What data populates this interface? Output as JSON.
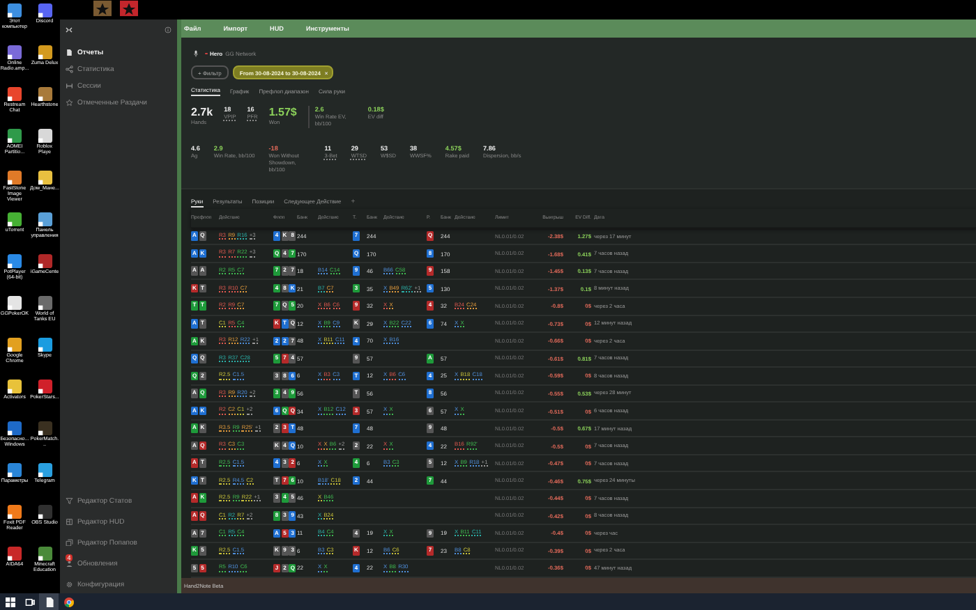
{
  "desktop": {
    "top_icons": [
      {
        "color": "#7a5a32"
      },
      {
        "color": "#c4262c"
      }
    ],
    "icons": [
      {
        "label": "Этот компьютер",
        "color": "#3d8fe0"
      },
      {
        "label": "Discord",
        "color": "#5865f2"
      },
      {
        "label": "Online Radio.amp...",
        "color": "#7a6ad8"
      },
      {
        "label": "Zuma Delux",
        "color": "#d39a1e"
      },
      {
        "label": "Restream Chat",
        "color": "#e8452c"
      },
      {
        "label": "Hearthstone",
        "color": "#a87a3a"
      },
      {
        "label": "AOMEI Partitio...",
        "color": "#2f9a4a"
      },
      {
        "label": "Roblox Playe",
        "color": "#d8d8d8"
      },
      {
        "label": "FastStone Image Viewer",
        "color": "#e07a28"
      },
      {
        "label": "Дом_Мане...",
        "color": "#e8c040"
      },
      {
        "label": "uTorrent",
        "color": "#46b034"
      },
      {
        "label": "Панель управления",
        "color": "#5aa0d8"
      },
      {
        "label": "PotPlayer (64-bit)",
        "color": "#2a8ae6"
      },
      {
        "label": "iGameCente",
        "color": "#b02828"
      },
      {
        "label": "GGPokerOK",
        "color": "#e4e4e4"
      },
      {
        "label": "World of Tanks EU",
        "color": "#6a6a6a"
      },
      {
        "label": "Google Chrome",
        "color": "#e2a020"
      },
      {
        "label": "Skype",
        "color": "#1a9ce0"
      },
      {
        "label": "Activators",
        "color": "#e8c23a"
      },
      {
        "label": "PokerStars...",
        "color": "#d0202a"
      },
      {
        "label": "Безопасно... Windows",
        "color": "#1e6ac8"
      },
      {
        "label": "PokerMatch...",
        "color": "#3a3020"
      },
      {
        "label": "Параметры",
        "color": "#2a86d8"
      },
      {
        "label": "Telegram",
        "color": "#2aa0e0"
      },
      {
        "label": "Foxit PDF Reader",
        "color": "#f07a1a"
      },
      {
        "label": "OBS Studio",
        "color": "#303030"
      },
      {
        "label": "AIDA64",
        "color": "#c82828"
      },
      {
        "label": "Minecraft Education",
        "color": "#4a8a3a"
      }
    ]
  },
  "sidebar": {
    "items": [
      {
        "label": "Отчеты",
        "kind": "document",
        "selected": true
      },
      {
        "label": "Статистика",
        "kind": "nodes",
        "selected": false
      },
      {
        "label": "Сессии",
        "kind": "bracket",
        "selected": false
      },
      {
        "label": "Отмеченные Раздачи",
        "kind": "star",
        "selected": false
      }
    ],
    "bottom_items": [
      {
        "label": "Редактор Статов",
        "kind": "funnel"
      },
      {
        "label": "Редактор HUD",
        "kind": "layout"
      },
      {
        "label": "Редактор Попапов",
        "kind": "windows"
      },
      {
        "label": "Обновления",
        "kind": "person",
        "badge": "4"
      },
      {
        "label": "Конфигурация",
        "kind": "gear"
      }
    ]
  },
  "menu": [
    "Файл",
    "Импорт",
    "HUD",
    "Инструменты"
  ],
  "header": {
    "player": "Hero",
    "network": "GG Network",
    "filter_button": "+ Фильтр",
    "date_chip": "From 30-08-2024 to 30-08-2024",
    "chip_close": "×",
    "tabs": [
      {
        "label": "Статистика",
        "selected": true
      },
      {
        "label": "График",
        "selected": false
      },
      {
        "label": "Префлоп диапазон",
        "selected": false
      },
      {
        "label": "Сила руки",
        "selected": false
      }
    ]
  },
  "stats": {
    "main": [
      {
        "value": "2.7k",
        "label": "Hands",
        "kind": "big",
        "underlined": false
      },
      {
        "value": "18",
        "label": "VPIP",
        "kind": "plain",
        "underlined": true
      },
      {
        "value": "16",
        "label": "PFR",
        "kind": "plain",
        "underlined": true
      },
      {
        "value": "1.57$",
        "label": "Won",
        "kind": "bigpositive",
        "underlined": false
      },
      {
        "value": "2.6",
        "label": "Win Rate EV, bb/100",
        "kind": "positive",
        "underlined": false
      },
      {
        "value": "0.18$",
        "label": "EV diff",
        "kind": "positive",
        "underlined": false
      }
    ],
    "more": [
      {
        "value": "4.6",
        "label": "Ag",
        "kind": "plain",
        "underlined": false
      },
      {
        "value": "2.9",
        "label": "Win Rate, bb/100",
        "kind": "positive",
        "underlined": false
      },
      {
        "value": "-18",
        "label": "Won Without Showdown, bb/100",
        "kind": "negative",
        "underlined": false
      },
      {
        "value": "11",
        "label": "3-Bet",
        "kind": "plain",
        "underlined": true
      },
      {
        "value": "29",
        "label": "WTSD",
        "kind": "plain",
        "underlined": true
      },
      {
        "value": "53",
        "label": "W$SD",
        "kind": "plain",
        "underlined": false
      },
      {
        "value": "38",
        "label": "WWSF%",
        "kind": "plain",
        "underlined": false
      },
      {
        "value": "4.57$",
        "label": "Rake paid",
        "kind": "positive",
        "underlined": false
      },
      {
        "value": "7.86",
        "label": "Dispersion, bb/s",
        "kind": "plain",
        "underlined": false
      }
    ]
  },
  "hands": {
    "tabs": [
      {
        "label": "Руки",
        "selected": true
      },
      {
        "label": "Результаты",
        "selected": false
      },
      {
        "label": "Позиции",
        "selected": false
      },
      {
        "label": "Следующее Действие",
        "selected": false
      }
    ],
    "add_tab": "+",
    "columns": [
      "Префлоп",
      "Действие",
      "Флоп",
      "Банк",
      "Действие",
      "Т.",
      "Банк",
      "Действие",
      "Р.",
      "Банк",
      "Действие",
      "Лимит",
      "Выигрыш",
      "EV Diff.",
      "Дата"
    ],
    "rows": [
      {
        "hole": [
          {
            "rank": "A",
            "color": "#1f6fd1"
          },
          {
            "rank": "Q",
            "color": "#555555"
          }
        ],
        "pre": [
          {
            "text": "R3",
            "color": "#e0584f"
          },
          {
            "text": "R9",
            "color": "#e09a3c"
          },
          {
            "text": "R16",
            "color": "#2bb0a8"
          },
          {
            "text": "+3",
            "color": "#9a9a9a"
          }
        ],
        "flop": [
          {
            "rank": "4",
            "color": "#1f6fd1"
          },
          {
            "rank": "K",
            "color": "#555555"
          },
          {
            "rank": "8",
            "color": "#555555"
          }
        ],
        "flop_pot": "244",
        "flop_act": [],
        "turn": {
          "rank": "7",
          "color": "#1f6fd1"
        },
        "turn_pot": "244",
        "turn_act": [],
        "river": {
          "rank": "Q",
          "color": "#b52a2a"
        },
        "river_pot": "244",
        "river_act": [],
        "limit": "NL0.01/0.02",
        "won": "-2.38$",
        "ev_diff": "1.27$",
        "ev_positive": true,
        "date": "через 17 минут"
      },
      {
        "hole": [
          {
            "rank": "A",
            "color": "#1f6fd1"
          },
          {
            "rank": "K",
            "color": "#1f6fd1"
          }
        ],
        "pre": [
          {
            "text": "R3",
            "color": "#e0584f"
          },
          {
            "text": "R7",
            "color": "#e0584f"
          },
          {
            "text": "R22",
            "color": "#3fb950"
          },
          {
            "text": "+3",
            "color": "#9a9a9a"
          }
        ],
        "flop": [
          {
            "rank": "Q",
            "color": "#1e9a3a"
          },
          {
            "rank": "4",
            "color": "#555555"
          },
          {
            "rank": "7",
            "color": "#1e9a3a"
          }
        ],
        "flop_pot": "170",
        "flop_act": [],
        "turn": {
          "rank": "Q",
          "color": "#1f6fd1"
        },
        "turn_pot": "170",
        "turn_act": [],
        "river": {
          "rank": "8",
          "color": "#1f6fd1"
        },
        "river_pot": "170",
        "river_act": [],
        "limit": "NL0.01/0.02",
        "won": "-1.68$",
        "ev_diff": "0.41$",
        "ev_positive": true,
        "date": "7 часов назад"
      },
      {
        "hole": [
          {
            "rank": "A",
            "color": "#555555"
          },
          {
            "rank": "A",
            "color": "#555555"
          }
        ],
        "pre": [
          {
            "text": "R2",
            "color": "#3fb950"
          },
          {
            "text": "R5",
            "color": "#3fb950"
          },
          {
            "text": "C7",
            "color": "#3fb950"
          }
        ],
        "flop": [
          {
            "rank": "7",
            "color": "#1e9a3a"
          },
          {
            "rank": "2",
            "color": "#555555"
          },
          {
            "rank": "7",
            "color": "#555555"
          }
        ],
        "flop_pot": "18",
        "flop_act": [
          {
            "text": "B14",
            "color": "#4f8fdc"
          },
          {
            "text": "C14",
            "color": "#3fb950"
          }
        ],
        "turn": {
          "rank": "9",
          "color": "#1f6fd1"
        },
        "turn_pot": "46",
        "turn_act": [
          {
            "text": "B66",
            "color": "#4f8fdc"
          },
          {
            "text": "C58",
            "color": "#3fb950"
          }
        ],
        "river": {
          "rank": "9",
          "color": "#b52a2a"
        },
        "river_pot": "158",
        "river_act": [],
        "limit": "NL0.01/0.02",
        "won": "-1.45$",
        "ev_diff": "0.13$",
        "ev_positive": true,
        "date": "7 часов назад"
      },
      {
        "hole": [
          {
            "rank": "K",
            "color": "#b52a2a"
          },
          {
            "rank": "T",
            "color": "#555555"
          }
        ],
        "pre": [
          {
            "text": "R3",
            "color": "#e0584f"
          },
          {
            "text": "R10",
            "color": "#e0584f"
          },
          {
            "text": "C7",
            "color": "#e09a3c"
          }
        ],
        "flop": [
          {
            "rank": "4",
            "color": "#1e9a3a"
          },
          {
            "rank": "8",
            "color": "#555555"
          },
          {
            "rank": "K",
            "color": "#1f6fd1"
          }
        ],
        "flop_pot": "21",
        "flop_act": [
          {
            "text": "B7",
            "color": "#2bb0a8"
          },
          {
            "text": "C7",
            "color": "#e09a3c"
          }
        ],
        "turn": {
          "rank": "3",
          "color": "#1e9a3a"
        },
        "turn_pot": "35",
        "turn_act": [
          {
            "text": "X",
            "color": "#4f8fdc"
          },
          {
            "text": "B49",
            "color": "#e09a3c"
          },
          {
            "text": "R62'",
            "color": "#2bb0a8"
          },
          {
            "text": "+1",
            "color": "#9a9a9a"
          }
        ],
        "river": {
          "rank": "5",
          "color": "#1f6fd1"
        },
        "river_pot": "130",
        "river_act": [],
        "limit": "NL0.01/0.02",
        "won": "-1.37$",
        "ev_diff": "0.1$",
        "ev_positive": true,
        "date": "8 минут назад"
      },
      {
        "hole": [
          {
            "rank": "T",
            "color": "#1e9a3a"
          },
          {
            "rank": "T",
            "color": "#1e9a3a"
          }
        ],
        "pre": [
          {
            "text": "R2",
            "color": "#e0584f"
          },
          {
            "text": "R9",
            "color": "#e0584f"
          },
          {
            "text": "C7",
            "color": "#e09a3c"
          }
        ],
        "flop": [
          {
            "rank": "7",
            "color": "#1e9a3a"
          },
          {
            "rank": "Q",
            "color": "#555555"
          },
          {
            "rank": "5",
            "color": "#1e9a3a"
          }
        ],
        "flop_pot": "20",
        "flop_act": [
          {
            "text": "X",
            "color": "#e0584f"
          },
          {
            "text": "B6",
            "color": "#e0584f"
          },
          {
            "text": "C6",
            "color": "#e0584f"
          }
        ],
        "turn": {
          "rank": "9",
          "color": "#b52a2a"
        },
        "turn_pot": "32",
        "turn_act": [
          {
            "text": "X",
            "color": "#e0584f"
          },
          {
            "text": "X",
            "color": "#e09a3c"
          }
        ],
        "river": {
          "rank": "4",
          "color": "#b52a2a"
        },
        "river_pot": "32",
        "river_act": [
          {
            "text": "B24",
            "color": "#e0584f"
          },
          {
            "text": "C24",
            "color": "#e09a3c"
          }
        ],
        "limit": "NL0.01/0.02",
        "won": "-0.8$",
        "ev_diff": "0$",
        "ev_positive": false,
        "date": "через 2 часа"
      },
      {
        "hole": [
          {
            "rank": "A",
            "color": "#1f6fd1"
          },
          {
            "rank": "T",
            "color": "#555555"
          }
        ],
        "pre": [
          {
            "text": "C1",
            "color": "#c9c23a"
          },
          {
            "text": "R5",
            "color": "#e0584f"
          },
          {
            "text": "C4",
            "color": "#3fb950"
          }
        ],
        "flop": [
          {
            "rank": "K",
            "color": "#b52a2a"
          },
          {
            "rank": "T",
            "color": "#1f6fd1"
          },
          {
            "rank": "Q",
            "color": "#555555"
          }
        ],
        "flop_pot": "12",
        "flop_act": [
          {
            "text": "X",
            "color": "#4f8fdc"
          },
          {
            "text": "B9",
            "color": "#3fb950"
          },
          {
            "text": "C9",
            "color": "#4f8fdc"
          }
        ],
        "turn": {
          "rank": "K",
          "color": "#555555"
        },
        "turn_pot": "29",
        "turn_act": [
          {
            "text": "X",
            "color": "#4f8fdc"
          },
          {
            "text": "B22",
            "color": "#3fb950"
          },
          {
            "text": "C22",
            "color": "#4f8fdc"
          }
        ],
        "river": {
          "rank": "6",
          "color": "#1f6fd1"
        },
        "river_pot": "74",
        "river_act": [
          {
            "text": "X",
            "color": "#4f8fdc"
          },
          {
            "text": "X",
            "color": "#3fb950"
          }
        ],
        "limit": "NL0.01/0.02",
        "won": "-0.73$",
        "ev_diff": "0$",
        "ev_positive": false,
        "date": "12 минут назад"
      },
      {
        "hole": [
          {
            "rank": "A",
            "color": "#1e9a3a"
          },
          {
            "rank": "K",
            "color": "#555555"
          }
        ],
        "pre": [
          {
            "text": "R3",
            "color": "#e0584f"
          },
          {
            "text": "R12",
            "color": "#e09a3c"
          },
          {
            "text": "R22",
            "color": "#4f8fdc"
          },
          {
            "text": "+1",
            "color": "#9a9a9a"
          }
        ],
        "flop": [
          {
            "rank": "2",
            "color": "#1f6fd1"
          },
          {
            "rank": "2",
            "color": "#1f6fd1"
          },
          {
            "rank": "7",
            "color": "#555555"
          }
        ],
        "flop_pot": "48",
        "flop_act": [
          {
            "text": "X",
            "color": "#4f8fdc"
          },
          {
            "text": "B11",
            "color": "#c9c23a"
          },
          {
            "text": "C11",
            "color": "#4f8fdc"
          }
        ],
        "turn": {
          "rank": "4",
          "color": "#1f6fd1"
        },
        "turn_pot": "70",
        "turn_act": [
          {
            "text": "X",
            "color": "#4f8fdc"
          },
          {
            "text": "B16",
            "color": "#4f8fdc"
          }
        ],
        "river": null,
        "river_act": [],
        "limit": "NL0.01/0.02",
        "won": "-0.66$",
        "ev_diff": "0$",
        "ev_positive": false,
        "date": "через 2 часа"
      },
      {
        "hole": [
          {
            "rank": "Q",
            "color": "#1f6fd1"
          },
          {
            "rank": "Q",
            "color": "#555555"
          }
        ],
        "pre": [
          {
            "text": "R3",
            "color": "#2bb0a8"
          },
          {
            "text": "R37",
            "color": "#2bb0a8"
          },
          {
            "text": "C28",
            "color": "#2bb0a8"
          }
        ],
        "flop": [
          {
            "rank": "5",
            "color": "#1e9a3a"
          },
          {
            "rank": "7",
            "color": "#b52a2a"
          },
          {
            "rank": "4",
            "color": "#555555"
          }
        ],
        "flop_pot": "57",
        "flop_act": [],
        "turn": {
          "rank": "9",
          "color": "#555555"
        },
        "turn_pot": "57",
        "turn_act": [],
        "river": {
          "rank": "A",
          "color": "#1e9a3a"
        },
        "river_pot": "57",
        "river_act": [],
        "limit": "NL0.01/0.02",
        "won": "-0.61$",
        "ev_diff": "0.81$",
        "ev_positive": true,
        "date": "7 часов назад"
      },
      {
        "hole": [
          {
            "rank": "Q",
            "color": "#1e9a3a"
          },
          {
            "rank": "2",
            "color": "#555555"
          }
        ],
        "pre": [
          {
            "text": "R2.5",
            "color": "#c9c23a"
          },
          {
            "text": "C1.5",
            "color": "#4f8fdc"
          }
        ],
        "flop": [
          {
            "rank": "3",
            "color": "#555555"
          },
          {
            "rank": "8",
            "color": "#555555"
          },
          {
            "rank": "6",
            "color": "#1f6fd1"
          }
        ],
        "flop_pot": "6",
        "flop_act": [
          {
            "text": "X",
            "color": "#4f8fdc"
          },
          {
            "text": "B3",
            "color": "#e0584f"
          },
          {
            "text": "C3",
            "color": "#4f8fdc"
          }
        ],
        "turn": {
          "rank": "T",
          "color": "#1f6fd1"
        },
        "turn_pot": "12",
        "turn_act": [
          {
            "text": "X",
            "color": "#4f8fdc"
          },
          {
            "text": "B6",
            "color": "#e0584f"
          },
          {
            "text": "C6",
            "color": "#4f8fdc"
          }
        ],
        "river": {
          "rank": "4",
          "color": "#1f6fd1"
        },
        "river_pot": "25",
        "river_act": [
          {
            "text": "X",
            "color": "#4f8fdc"
          },
          {
            "text": "B18",
            "color": "#c9c23a"
          },
          {
            "text": "C18",
            "color": "#4f8fdc"
          }
        ],
        "limit": "NL0.01/0.02",
        "won": "-0.59$",
        "ev_diff": "0$",
        "ev_positive": false,
        "date": "8 часов назад"
      },
      {
        "hole": [
          {
            "rank": "A",
            "color": "#555555"
          },
          {
            "rank": "Q",
            "color": "#1e9a3a"
          }
        ],
        "pre": [
          {
            "text": "R3",
            "color": "#e0584f"
          },
          {
            "text": "R9",
            "color": "#e09a3c"
          },
          {
            "text": "R20",
            "color": "#4f8fdc"
          },
          {
            "text": "+2",
            "color": "#9a9a9a"
          }
        ],
        "flop": [
          {
            "rank": "3",
            "color": "#1e9a3a"
          },
          {
            "rank": "4",
            "color": "#555555"
          },
          {
            "rank": "9",
            "color": "#1e9a3a"
          }
        ],
        "flop_pot": "56",
        "flop_act": [],
        "turn": {
          "rank": "T",
          "color": "#555555"
        },
        "turn_pot": "56",
        "turn_act": [],
        "river": {
          "rank": "8",
          "color": "#1f6fd1"
        },
        "river_pot": "56",
        "river_act": [],
        "limit": "NL0.01/0.02",
        "won": "-0.55$",
        "ev_diff": "0.53$",
        "ev_positive": true,
        "date": "через 28 минут"
      },
      {
        "hole": [
          {
            "rank": "A",
            "color": "#1f6fd1"
          },
          {
            "rank": "K",
            "color": "#1f6fd1"
          }
        ],
        "pre": [
          {
            "text": "R2",
            "color": "#e0584f"
          },
          {
            "text": "C2",
            "color": "#e09a3c"
          },
          {
            "text": "C1",
            "color": "#c9c23a"
          },
          {
            "text": "+2",
            "color": "#9a9a9a"
          }
        ],
        "flop": [
          {
            "rank": "6",
            "color": "#1f6fd1"
          },
          {
            "rank": "Q",
            "color": "#1e9a3a"
          },
          {
            "rank": "Q",
            "color": "#b52a2a"
          }
        ],
        "flop_pot": "34",
        "flop_act": [
          {
            "text": "X",
            "color": "#4f8fdc"
          },
          {
            "text": "B12",
            "color": "#3fb950"
          },
          {
            "text": "C12",
            "color": "#4f8fdc"
          }
        ],
        "turn": {
          "rank": "3",
          "color": "#b52a2a"
        },
        "turn_pot": "57",
        "turn_act": [
          {
            "text": "X",
            "color": "#4f8fdc"
          },
          {
            "text": "X",
            "color": "#3fb950"
          }
        ],
        "river": {
          "rank": "6",
          "color": "#555555"
        },
        "river_pot": "57",
        "river_act": [
          {
            "text": "X",
            "color": "#4f8fdc"
          },
          {
            "text": "X",
            "color": "#3fb950"
          }
        ],
        "limit": "NL0.01/0.02",
        "won": "-0.51$",
        "ev_diff": "0$",
        "ev_positive": false,
        "date": "6 часов назад"
      },
      {
        "hole": [
          {
            "rank": "A",
            "color": "#1e9a3a"
          },
          {
            "rank": "K",
            "color": "#555555"
          }
        ],
        "pre": [
          {
            "text": "R3.5",
            "color": "#e09a3c"
          },
          {
            "text": "R9",
            "color": "#3fb950"
          },
          {
            "text": "R25'",
            "color": "#e09a3c"
          },
          {
            "text": "+1",
            "color": "#9a9a9a"
          }
        ],
        "flop": [
          {
            "rank": "2",
            "color": "#555555"
          },
          {
            "rank": "3",
            "color": "#b52a2a"
          },
          {
            "rank": "T",
            "color": "#1f6fd1"
          }
        ],
        "flop_pot": "48",
        "flop_act": [],
        "turn": {
          "rank": "7",
          "color": "#1f6fd1"
        },
        "turn_pot": "48",
        "turn_act": [],
        "river": {
          "rank": "9",
          "color": "#555555"
        },
        "river_pot": "48",
        "river_act": [],
        "limit": "NL0.01/0.02",
        "won": "-0.5$",
        "ev_diff": "0.67$",
        "ev_positive": true,
        "date": "17 минут назад"
      },
      {
        "hole": [
          {
            "rank": "A",
            "color": "#555555"
          },
          {
            "rank": "Q",
            "color": "#b52a2a"
          }
        ],
        "pre": [
          {
            "text": "R3",
            "color": "#e0584f"
          },
          {
            "text": "C3",
            "color": "#e09a3c"
          },
          {
            "text": "C3",
            "color": "#3fb950"
          }
        ],
        "flop": [
          {
            "rank": "K",
            "color": "#555555"
          },
          {
            "rank": "4",
            "color": "#555555"
          },
          {
            "rank": "Q",
            "color": "#1f6fd1"
          }
        ],
        "flop_pot": "10",
        "flop_act": [
          {
            "text": "X",
            "color": "#e0584f"
          },
          {
            "text": "X",
            "color": "#e09a3c"
          },
          {
            "text": "B6",
            "color": "#3fb950"
          },
          {
            "text": "+2",
            "color": "#9a9a9a"
          }
        ],
        "turn": {
          "rank": "2",
          "color": "#555555"
        },
        "turn_pot": "22",
        "turn_act": [
          {
            "text": "X",
            "color": "#e0584f"
          },
          {
            "text": "X",
            "color": "#3fb950"
          }
        ],
        "river": {
          "rank": "4",
          "color": "#1f6fd1"
        },
        "river_pot": "22",
        "river_act": [
          {
            "text": "B16",
            "color": "#e0584f"
          },
          {
            "text": "R92'",
            "color": "#3fb950"
          }
        ],
        "limit": "NL0.01/0.02",
        "won": "-0.5$",
        "ev_diff": "0$",
        "ev_positive": false,
        "date": "7 часов назад"
      },
      {
        "hole": [
          {
            "rank": "A",
            "color": "#b52a2a"
          },
          {
            "rank": "T",
            "color": "#555555"
          }
        ],
        "pre": [
          {
            "text": "R2.5",
            "color": "#3fb950"
          },
          {
            "text": "C1.5",
            "color": "#4f8fdc"
          }
        ],
        "flop": [
          {
            "rank": "4",
            "color": "#1f6fd1"
          },
          {
            "rank": "3",
            "color": "#555555"
          },
          {
            "rank": "2",
            "color": "#b52a2a"
          }
        ],
        "flop_pot": "6",
        "flop_act": [
          {
            "text": "X",
            "color": "#4f8fdc"
          },
          {
            "text": "X",
            "color": "#3fb950"
          }
        ],
        "turn": {
          "rank": "4",
          "color": "#1e9a3a"
        },
        "turn_pot": "6",
        "turn_act": [
          {
            "text": "B3",
            "color": "#4f8fdc"
          },
          {
            "text": "C3",
            "color": "#3fb950"
          }
        ],
        "river": {
          "rank": "5",
          "color": "#555555"
        },
        "river_pot": "12",
        "river_act": [
          {
            "text": "X",
            "color": "#4f8fdc"
          },
          {
            "text": "B9",
            "color": "#3fb950"
          },
          {
            "text": "R18",
            "color": "#4f8fdc"
          },
          {
            "text": "+1",
            "color": "#9a9a9a"
          }
        ],
        "limit": "NL0.01/0.02",
        "won": "-0.47$",
        "ev_diff": "0$",
        "ev_positive": false,
        "date": "7 часов назад"
      },
      {
        "hole": [
          {
            "rank": "K",
            "color": "#1f6fd1"
          },
          {
            "rank": "T",
            "color": "#555555"
          }
        ],
        "pre": [
          {
            "text": "R2.5",
            "color": "#c9c23a"
          },
          {
            "text": "R4.5",
            "color": "#4f8fdc"
          },
          {
            "text": "C2",
            "color": "#c9c23a"
          }
        ],
        "flop": [
          {
            "rank": "T",
            "color": "#555555"
          },
          {
            "rank": "7",
            "color": "#b52a2a"
          },
          {
            "rank": "6",
            "color": "#1e9a3a"
          }
        ],
        "flop_pot": "10",
        "flop_act": [
          {
            "text": "B18'",
            "color": "#4f8fdc"
          },
          {
            "text": "C18",
            "color": "#c9c23a"
          }
        ],
        "turn": {
          "rank": "2",
          "color": "#1f6fd1"
        },
        "turn_pot": "44",
        "turn_act": [],
        "river": {
          "rank": "7",
          "color": "#1e9a3a"
        },
        "river_pot": "44",
        "river_act": [],
        "limit": "NL0.01/0.02",
        "won": "-0.46$",
        "ev_diff": "0.75$",
        "ev_positive": true,
        "date": "через 24 минуты"
      },
      {
        "hole": [
          {
            "rank": "A",
            "color": "#b52a2a"
          },
          {
            "rank": "K",
            "color": "#1e9a3a"
          }
        ],
        "pre": [
          {
            "text": "R2.5",
            "color": "#c9c23a"
          },
          {
            "text": "R9",
            "color": "#3fb950"
          },
          {
            "text": "R22",
            "color": "#c9c23a"
          },
          {
            "text": "+1",
            "color": "#9a9a9a"
          }
        ],
        "flop": [
          {
            "rank": "3",
            "color": "#555555"
          },
          {
            "rank": "4",
            "color": "#1e9a3a"
          },
          {
            "rank": "5",
            "color": "#555555"
          }
        ],
        "flop_pot": "46",
        "flop_act": [
          {
            "text": "X",
            "color": "#c9c23a"
          },
          {
            "text": "B46",
            "color": "#3fb950"
          }
        ],
        "turn": null,
        "turn_act": [],
        "river": null,
        "river_act": [],
        "limit": "NL0.01/0.02",
        "won": "-0.44$",
        "ev_diff": "0$",
        "ev_positive": false,
        "date": "7 часов назад"
      },
      {
        "hole": [
          {
            "rank": "A",
            "color": "#b52a2a"
          },
          {
            "rank": "Q",
            "color": "#b52a2a"
          }
        ],
        "pre": [
          {
            "text": "C1",
            "color": "#c9c23a"
          },
          {
            "text": "R2",
            "color": "#2bb0a8"
          },
          {
            "text": "R7",
            "color": "#c9c23a"
          },
          {
            "text": "+2",
            "color": "#9a9a9a"
          }
        ],
        "flop": [
          {
            "rank": "8",
            "color": "#1e9a3a"
          },
          {
            "rank": "3",
            "color": "#555555"
          },
          {
            "rank": "9",
            "color": "#1f6fd1"
          }
        ],
        "flop_pot": "43",
        "flop_act": [
          {
            "text": "X",
            "color": "#2bb0a8"
          },
          {
            "text": "B24",
            "color": "#c9c23a"
          }
        ],
        "turn": null,
        "turn_act": [],
        "river": null,
        "river_act": [],
        "limit": "NL0.01/0.02",
        "won": "-0.42$",
        "ev_diff": "0$",
        "ev_positive": false,
        "date": "8 часов назад"
      },
      {
        "hole": [
          {
            "rank": "A",
            "color": "#555555"
          },
          {
            "rank": "7",
            "color": "#555555"
          }
        ],
        "pre": [
          {
            "text": "C1",
            "color": "#3fb950"
          },
          {
            "text": "R5",
            "color": "#2bb0a8"
          },
          {
            "text": "C4",
            "color": "#3fb950"
          }
        ],
        "flop": [
          {
            "rank": "A",
            "color": "#1f6fd1"
          },
          {
            "rank": "5",
            "color": "#b52a2a"
          },
          {
            "rank": "3",
            "color": "#1f6fd1"
          }
        ],
        "flop_pot": "11",
        "flop_act": [
          {
            "text": "B4",
            "color": "#2bb0a8"
          },
          {
            "text": "C4",
            "color": "#3fb950"
          }
        ],
        "turn": {
          "rank": "4",
          "color": "#555555"
        },
        "turn_pot": "19",
        "turn_act": [
          {
            "text": "X",
            "color": "#2bb0a8"
          },
          {
            "text": "X",
            "color": "#3fb950"
          }
        ],
        "river": {
          "rank": "9",
          "color": "#555555"
        },
        "river_pot": "19",
        "river_act": [
          {
            "text": "X",
            "color": "#2bb0a8"
          },
          {
            "text": "B11",
            "color": "#3fb950"
          },
          {
            "text": "C11",
            "color": "#2bb0a8"
          }
        ],
        "limit": "NL0.01/0.02",
        "won": "-0.4$",
        "ev_diff": "0$",
        "ev_positive": false,
        "date": "через час"
      },
      {
        "hole": [
          {
            "rank": "K",
            "color": "#1e9a3a"
          },
          {
            "rank": "5",
            "color": "#555555"
          }
        ],
        "pre": [
          {
            "text": "R2.5",
            "color": "#c9c23a"
          },
          {
            "text": "C1.5",
            "color": "#4f8fdc"
          }
        ],
        "flop": [
          {
            "rank": "K",
            "color": "#555555"
          },
          {
            "rank": "9",
            "color": "#555555"
          },
          {
            "rank": "3",
            "color": "#555555"
          }
        ],
        "flop_pot": "6",
        "flop_act": [
          {
            "text": "B3",
            "color": "#4f8fdc"
          },
          {
            "text": "C3",
            "color": "#c9c23a"
          }
        ],
        "turn": {
          "rank": "K",
          "color": "#b52a2a"
        },
        "turn_pot": "12",
        "turn_act": [
          {
            "text": "B6",
            "color": "#4f8fdc"
          },
          {
            "text": "C6",
            "color": "#c9c23a"
          }
        ],
        "river": {
          "rank": "7",
          "color": "#b52a2a"
        },
        "river_pot": "23",
        "river_act": [
          {
            "text": "B8",
            "color": "#4f8fdc"
          },
          {
            "text": "C8",
            "color": "#c9c23a"
          }
        ],
        "limit": "NL0.01/0.02",
        "won": "-0.39$",
        "ev_diff": "0$",
        "ev_positive": false,
        "date": "через 2 часа"
      },
      {
        "hole": [
          {
            "rank": "5",
            "color": "#555555"
          },
          {
            "rank": "5",
            "color": "#b52a2a"
          }
        ],
        "pre": [
          {
            "text": "R5",
            "color": "#3fb950"
          },
          {
            "text": "R10",
            "color": "#4f8fdc"
          },
          {
            "text": "C6",
            "color": "#3fb950"
          }
        ],
        "flop": [
          {
            "rank": "J",
            "color": "#b52a2a"
          },
          {
            "rank": "2",
            "color": "#555555"
          },
          {
            "rank": "Q",
            "color": "#1e9a3a"
          }
        ],
        "flop_pot": "22",
        "flop_act": [
          {
            "text": "X",
            "color": "#4f8fdc"
          },
          {
            "text": "X",
            "color": "#3fb950"
          }
        ],
        "turn": {
          "rank": "4",
          "color": "#1f6fd1"
        },
        "turn_pot": "22",
        "turn_act": [
          {
            "text": "X",
            "color": "#4f8fdc"
          },
          {
            "text": "B8",
            "color": "#3fb950"
          },
          {
            "text": "R30",
            "color": "#4f8fdc"
          }
        ],
        "river": null,
        "river_act": [],
        "limit": "NL0.01/0.02",
        "won": "-0.36$",
        "ev_diff": "0$",
        "ev_positive": false,
        "date": "47 минут назад"
      }
    ]
  },
  "status_bar": "Hand2Note Beta",
  "taskbar": [
    {
      "kind": "start",
      "selected": false
    },
    {
      "kind": "taskview",
      "selected": false
    },
    {
      "kind": "file",
      "selected": true
    },
    {
      "kind": "chrome",
      "selected": false
    }
  ]
}
